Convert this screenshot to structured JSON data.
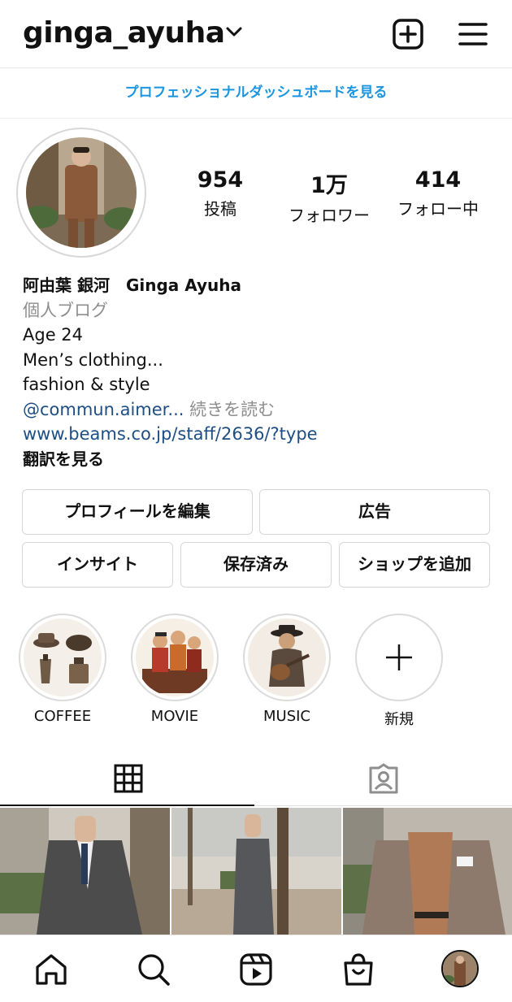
{
  "header": {
    "username": "ginga_ayuha",
    "icons": {
      "dropdown": "chevron-down-icon",
      "create": "plus-square-icon",
      "menu": "hamburger-menu-icon"
    }
  },
  "dashboard_link": "プロフェッショナルダッシュボードを見る",
  "stats": [
    {
      "value": "954",
      "label": "投稿"
    },
    {
      "value": "1万",
      "label": "フォロワー"
    },
    {
      "value": "414",
      "label": "フォロー中"
    }
  ],
  "bio": {
    "name": "阿由葉 銀河　Ginga Ayuha",
    "category": "個人ブログ",
    "lines": [
      "Age 24",
      "Men’s clothing...",
      "fashion & style"
    ],
    "mention": "@commun.aimer...",
    "more_label": "続きを読む",
    "url": "www.beams.co.jp/staff/2636/?type",
    "translate_label": "翻訳を見る"
  },
  "buttons": {
    "edit_profile": "プロフィールを編集",
    "ads": "広告",
    "insights": "インサイト",
    "saved": "保存済み",
    "add_shop": "ショップを追加"
  },
  "highlights": [
    {
      "label": "COFFEE",
      "icon": "coffee-illustration"
    },
    {
      "label": "MOVIE",
      "icon": "movie-illustration"
    },
    {
      "label": "MUSIC",
      "icon": "music-illustration"
    },
    {
      "label": "新規",
      "icon": "plus-icon"
    }
  ],
  "tabs": [
    {
      "icon": "grid-icon",
      "active": true
    },
    {
      "icon": "tagged-icon",
      "active": false
    }
  ],
  "bottom_nav": [
    "home-icon",
    "search-icon",
    "reels-icon",
    "shop-icon",
    "profile-avatar"
  ],
  "colors": {
    "link_blue": "#1b95e0",
    "bio_link": "#1d4f85",
    "muted": "#8e8e8e",
    "border": "#d6d6d6"
  }
}
